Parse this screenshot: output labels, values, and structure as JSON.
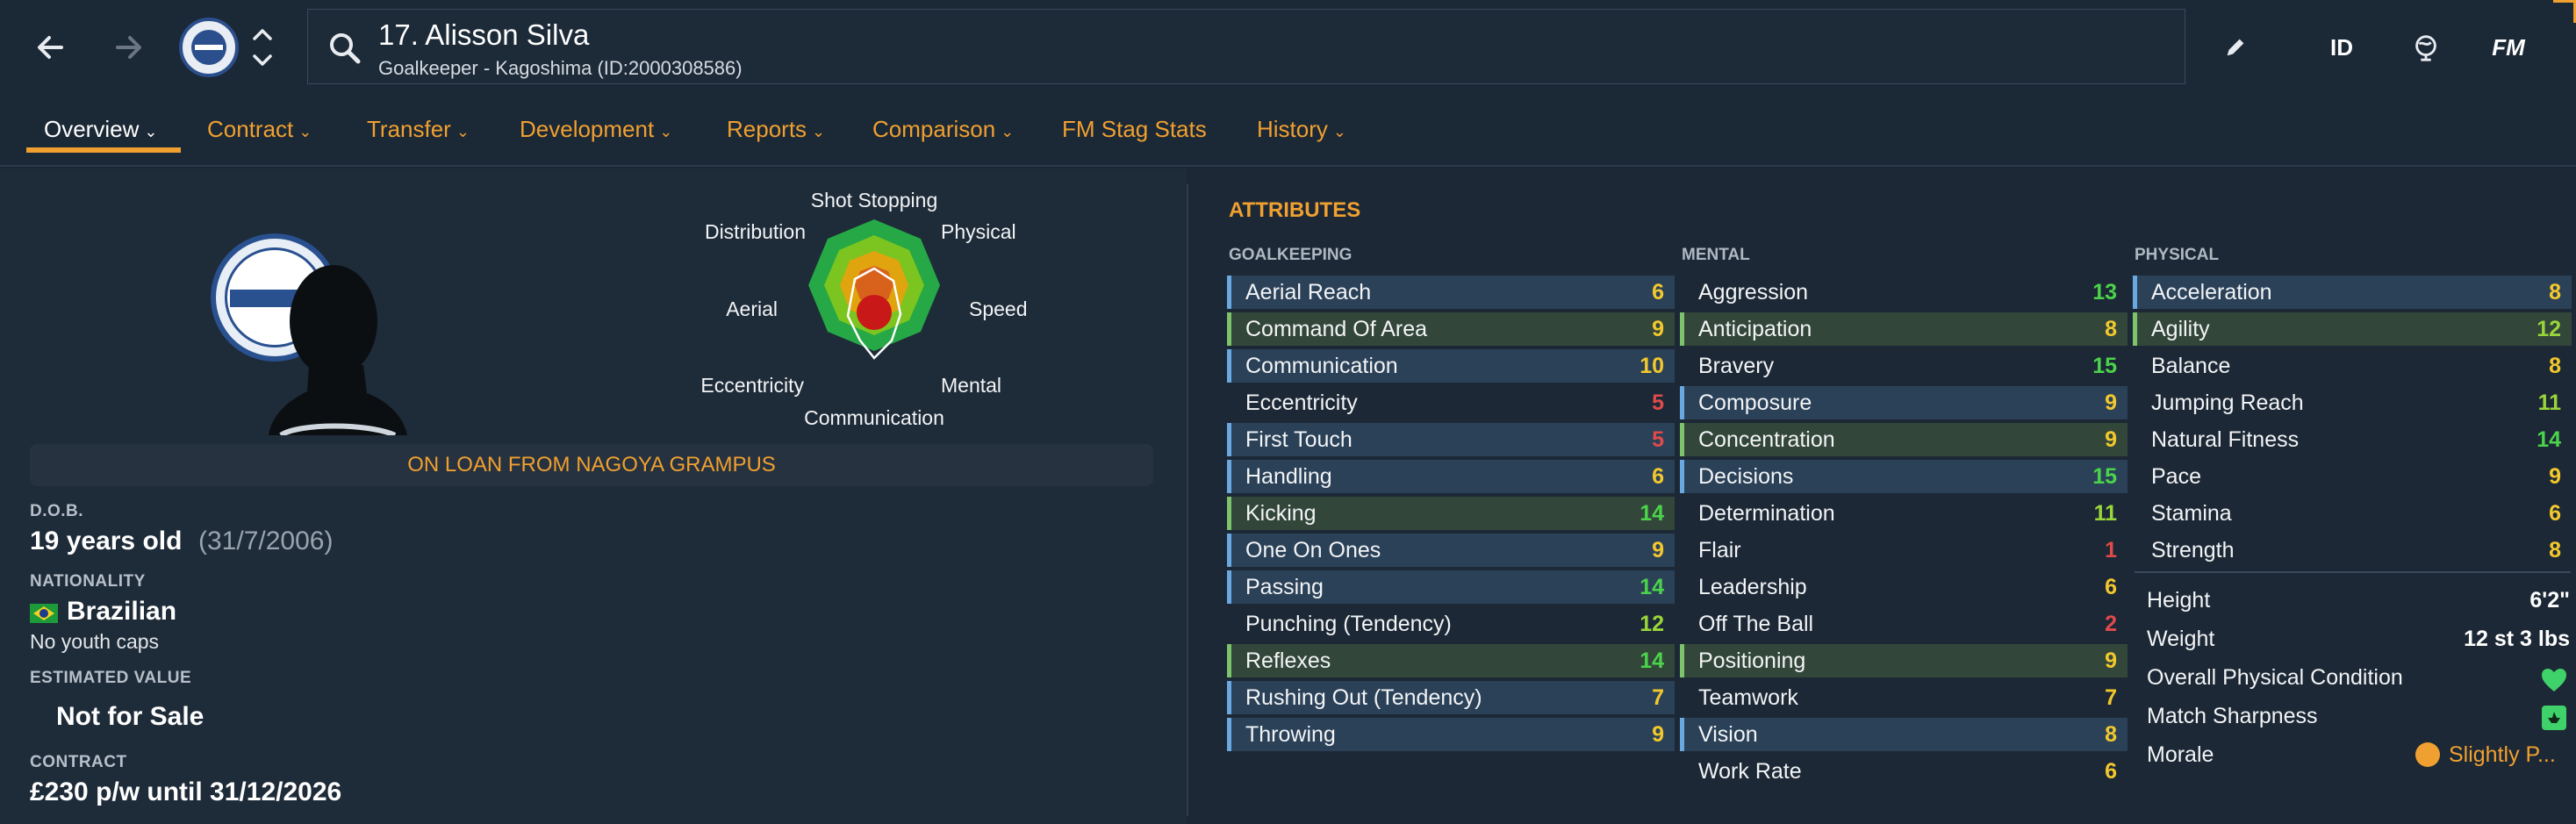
{
  "header": {
    "player_name": "17. Alisson Silva",
    "subtitle": "Goalkeeper - Kagoshima (ID:2000308586)",
    "id_label": "ID",
    "fm_label": "FM"
  },
  "tabs": [
    {
      "label": "Overview",
      "active": true
    },
    {
      "label": "Contract"
    },
    {
      "label": "Transfer"
    },
    {
      "label": "Development"
    },
    {
      "label": "Reports"
    },
    {
      "label": "Comparison"
    },
    {
      "label": "FM Stag Stats"
    },
    {
      "label": "History"
    }
  ],
  "radar": {
    "labels": [
      "Shot Stopping",
      "Physical",
      "Speed",
      "Mental",
      "Communication",
      "Eccentricity",
      "Aerial",
      "Distribution"
    ]
  },
  "loan_banner": "ON LOAN FROM NAGOYA GRAMPUS",
  "profile": {
    "dob_label": "D.O.B.",
    "age": "19 years old",
    "dob": "(31/7/2006)",
    "nationality_label": "NATIONALITY",
    "nationality": "Brazilian",
    "youth_caps": "No youth caps",
    "value_label": "ESTIMATED VALUE",
    "value": "Not for Sale",
    "contract_label": "CONTRACT",
    "contract": "£230 p/w until 31/12/2026"
  },
  "attributes": {
    "title": "ATTRIBUTES",
    "goalkeeping": {
      "heading": "GOALKEEPING",
      "items": [
        {
          "name": "Aerial Reach",
          "value": "6",
          "hl": "bb"
        },
        {
          "name": "Command Of Area",
          "value": "9",
          "hl": "bg"
        },
        {
          "name": "Communication",
          "value": "10",
          "hl": "bb"
        },
        {
          "name": "Eccentricity",
          "value": "5",
          "hl": "nb"
        },
        {
          "name": "First Touch",
          "value": "5",
          "hl": "bb"
        },
        {
          "name": "Handling",
          "value": "6",
          "hl": "bb"
        },
        {
          "name": "Kicking",
          "value": "14",
          "hl": "bg"
        },
        {
          "name": "One On Ones",
          "value": "9",
          "hl": "bb"
        },
        {
          "name": "Passing",
          "value": "14",
          "hl": "bb"
        },
        {
          "name": "Punching (Tendency)",
          "value": "12",
          "hl": "nb"
        },
        {
          "name": "Reflexes",
          "value": "14",
          "hl": "bg"
        },
        {
          "name": "Rushing Out (Tendency)",
          "value": "7",
          "hl": "bb"
        },
        {
          "name": "Throwing",
          "value": "9",
          "hl": "bb"
        }
      ]
    },
    "mental": {
      "heading": "MENTAL",
      "items": [
        {
          "name": "Aggression",
          "value": "13",
          "hl": "nb"
        },
        {
          "name": "Anticipation",
          "value": "8",
          "hl": "bg"
        },
        {
          "name": "Bravery",
          "value": "15",
          "hl": "nb"
        },
        {
          "name": "Composure",
          "value": "9",
          "hl": "bb"
        },
        {
          "name": "Concentration",
          "value": "9",
          "hl": "bg"
        },
        {
          "name": "Decisions",
          "value": "15",
          "hl": "bb"
        },
        {
          "name": "Determination",
          "value": "11",
          "hl": "nb"
        },
        {
          "name": "Flair",
          "value": "1",
          "hl": "nb"
        },
        {
          "name": "Leadership",
          "value": "6",
          "hl": "nb"
        },
        {
          "name": "Off The Ball",
          "value": "2",
          "hl": "nb"
        },
        {
          "name": "Positioning",
          "value": "9",
          "hl": "bg"
        },
        {
          "name": "Teamwork",
          "value": "7",
          "hl": "nb"
        },
        {
          "name": "Vision",
          "value": "8",
          "hl": "bb"
        },
        {
          "name": "Work Rate",
          "value": "6",
          "hl": "nb"
        }
      ]
    },
    "physical": {
      "heading": "PHYSICAL",
      "items": [
        {
          "name": "Acceleration",
          "value": "8",
          "hl": "bb"
        },
        {
          "name": "Agility",
          "value": "12",
          "hl": "bg"
        },
        {
          "name": "Balance",
          "value": "8",
          "hl": "nb"
        },
        {
          "name": "Jumping Reach",
          "value": "11",
          "hl": "nb"
        },
        {
          "name": "Natural Fitness",
          "value": "14",
          "hl": "nb"
        },
        {
          "name": "Pace",
          "value": "9",
          "hl": "nb"
        },
        {
          "name": "Stamina",
          "value": "6",
          "hl": "nb"
        },
        {
          "name": "Strength",
          "value": "8",
          "hl": "nb"
        }
      ]
    }
  },
  "physical_info": [
    {
      "label": "Height",
      "value": "6'2\""
    },
    {
      "label": "Weight",
      "value": "12 st 3 lbs"
    },
    {
      "label": "Overall Physical Condition",
      "value": ""
    },
    {
      "label": "Match Sharpness",
      "value": ""
    },
    {
      "label": "Morale",
      "value": "Slightly P..."
    }
  ]
}
